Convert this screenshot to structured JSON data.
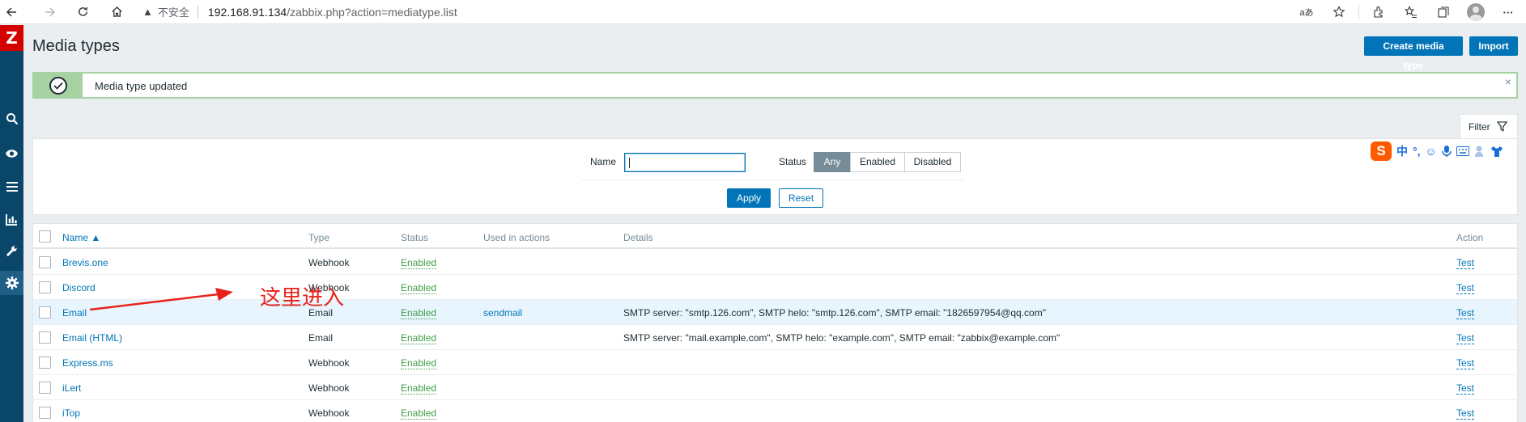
{
  "browser": {
    "back_icon": "arrow-left",
    "forward_icon": "arrow-right",
    "insecure_label": "不安全",
    "url_host": "192.168.91.134",
    "url_path": "/zabbix.php?action=mediatype.list",
    "read_aloud": "aあ",
    "more": "···"
  },
  "sidebar": {
    "logo": "Z",
    "icons": [
      "search-icon",
      "eye-icon",
      "list-icon",
      "bar-chart-icon",
      "wrench-icon",
      "gear-icon"
    ]
  },
  "header": {
    "title": "Media types",
    "create_button": "Create media type",
    "import_button": "Import"
  },
  "message": {
    "text": "Media type updated",
    "close": "×"
  },
  "filter": {
    "tab_label": "Filter",
    "name_label": "Name",
    "name_value": "",
    "status_label": "Status",
    "status_options": [
      "Any",
      "Enabled",
      "Disabled"
    ],
    "status_selected": "Any",
    "apply_label": "Apply",
    "reset_label": "Reset"
  },
  "ime_toolbar": {
    "logo": "S",
    "items": [
      "中",
      "°,",
      "☺",
      "🎤",
      "⌨",
      "👕"
    ]
  },
  "table": {
    "columns": {
      "name": "Name ▲",
      "type": "Type",
      "status": "Status",
      "used_in_actions": "Used in actions",
      "details": "Details",
      "action": "Action"
    },
    "rows": [
      {
        "name": "Brevis.one",
        "type": "Webhook",
        "status": "Enabled",
        "used": "",
        "details": "",
        "action": "Test"
      },
      {
        "name": "Discord",
        "type": "Webhook",
        "status": "Enabled",
        "used": "",
        "details": "",
        "action": "Test"
      },
      {
        "name": "Email",
        "type": "Email",
        "status": "Enabled",
        "used": "sendmail",
        "details": "SMTP server: \"smtp.126.com\", SMTP helo: \"smtp.126.com\", SMTP email: \"1826597954@qq.com\"",
        "action": "Test"
      },
      {
        "name": "Email (HTML)",
        "type": "Email",
        "status": "Enabled",
        "used": "",
        "details": "SMTP server: \"mail.example.com\", SMTP helo: \"example.com\", SMTP email: \"zabbix@example.com\"",
        "action": "Test"
      },
      {
        "name": "Express.ms",
        "type": "Webhook",
        "status": "Enabled",
        "used": "",
        "details": "",
        "action": "Test"
      },
      {
        "name": "iLert",
        "type": "Webhook",
        "status": "Enabled",
        "used": "",
        "details": "",
        "action": "Test"
      },
      {
        "name": "iTop",
        "type": "Webhook",
        "status": "Enabled",
        "used": "",
        "details": "",
        "action": "Test"
      }
    ]
  },
  "annotation": {
    "text": "这里进入",
    "color": "#e8221b"
  },
  "colors": {
    "brand_blue": "#0275b8",
    "sidebar": "#0a466a",
    "logo_red": "#d40000",
    "success_green": "#a7d3a2",
    "enabled_green": "#429e47"
  }
}
